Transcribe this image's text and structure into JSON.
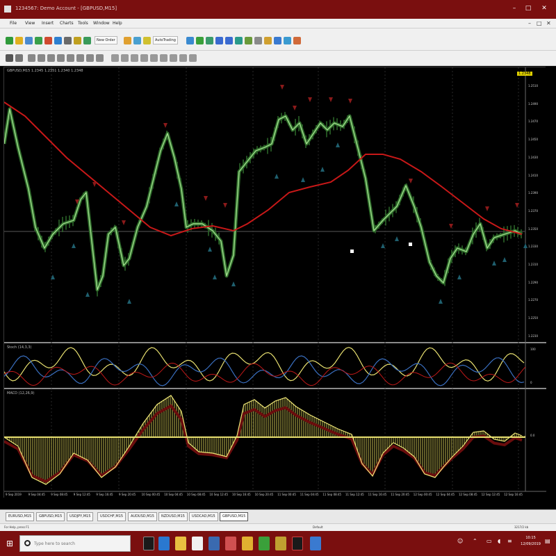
{
  "window": {
    "title": "1234567: Demo Account - [GBPUSD,M15]",
    "controls": [
      "–",
      "□",
      "✕"
    ]
  },
  "menu": {
    "items": [
      "File",
      "View",
      "Insert",
      "Charts",
      "Tools",
      "Window",
      "Help"
    ],
    "right_controls": [
      "–",
      "□",
      "✕"
    ]
  },
  "toolbar": {
    "new_order_label": "New Order",
    "autotrading_label": "AutoTrading"
  },
  "chart": {
    "main_label": "GBPUSD,M15  1.2345 1.2351 1.2340 1.2348",
    "price_tag": "1.2348",
    "osc1_label": "Stoch (14,3,3)",
    "osc2_label": "MACD (12,26,9)",
    "price_axis": [
      "1.2510",
      "1.2490",
      "1.2470",
      "1.2450",
      "1.2430",
      "1.2410",
      "1.2390",
      "1.2370",
      "1.2350",
      "1.2330",
      "1.2310",
      "1.2290",
      "1.2270",
      "1.2250",
      "1.2230"
    ],
    "osc1_axis": [
      "100",
      "0"
    ],
    "osc2_axis": [
      "0.0"
    ],
    "time_axis": [
      "9 Sep 2019",
      "9 Sep 04:45",
      "9 Sep 08:45",
      "9 Sep 12:45",
      "9 Sep 16:45",
      "9 Sep 20:45",
      "10 Sep 00:45",
      "10 Sep 04:45",
      "10 Sep 08:45",
      "10 Sep 12:45",
      "10 Sep 16:45",
      "10 Sep 20:45",
      "11 Sep 00:45",
      "11 Sep 04:45",
      "11 Sep 08:45",
      "11 Sep 12:45",
      "11 Sep 16:45",
      "11 Sep 20:45",
      "12 Sep 00:45",
      "12 Sep 04:45",
      "12 Sep 08:45",
      "12 Sep 12:45",
      "12 Sep 16:45"
    ],
    "colors": {
      "background": "#000000",
      "price_line": "#9fdc8c",
      "price_shadow": "#2e6b2a",
      "moving_average": "#c81818",
      "buy_arrow": "#1f5f6e",
      "sell_arrow": "#8a1a1a",
      "osc_yellow": "#e8e070",
      "osc_blue": "#3a6fc0",
      "osc_red": "#c01818",
      "macd_hist": "#d8cf5a",
      "macd_signal": "#6a0d0d"
    }
  },
  "tabs": [
    "EURUSD,M15",
    "GBPUSD,M15",
    "USDJPY,M15",
    "USDCHF,M15",
    "AUDUSD,M15",
    "NZDUSD,M15",
    "USDCAD,M15",
    "GBPUSD,M15"
  ],
  "status": {
    "help": "For Help, press F1",
    "profile": "Default",
    "connection": "3217/2 kb"
  },
  "taskbar": {
    "search_placeholder": "Type here to search",
    "time": "10:15",
    "date": "12/09/2019"
  }
}
